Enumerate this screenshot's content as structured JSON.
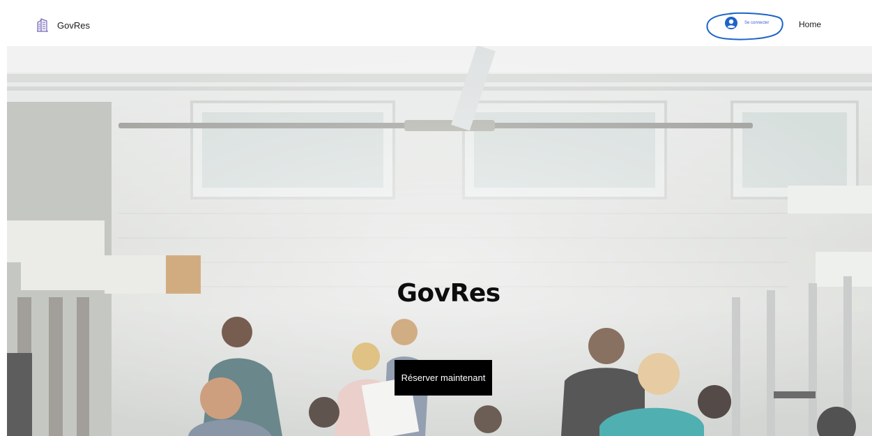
{
  "header": {
    "logo": {
      "icon": "building-icon",
      "text": "GovRes"
    },
    "login": {
      "icon": "user-avatar-icon",
      "label": "Se connecter"
    },
    "nav": [
      {
        "label": "Home"
      }
    ]
  },
  "hero": {
    "title": "GovRes",
    "cta_label": "Réserver maintenant",
    "image": "office-workspace-photo"
  },
  "colors": {
    "login_accent": "#3b5bdb",
    "annotation": "#1a64c8",
    "cta_background": "#000000"
  }
}
